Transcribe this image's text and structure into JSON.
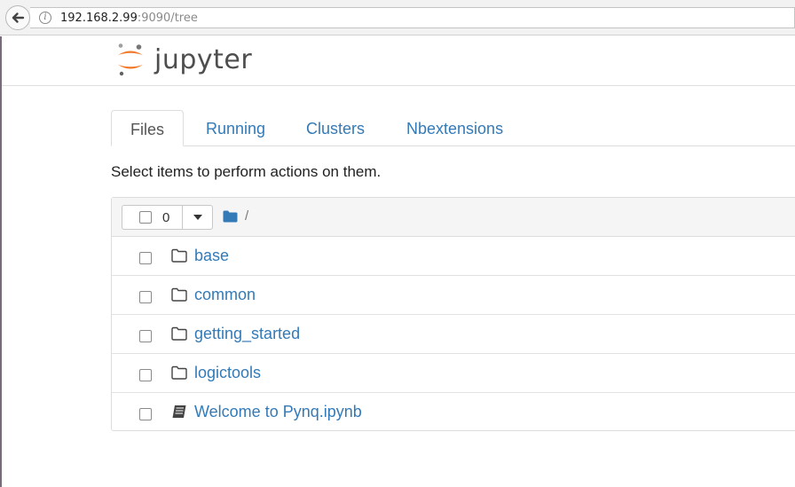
{
  "browser": {
    "url_host": "192.168.2.99",
    "url_rest": ":9090/tree"
  },
  "header": {
    "logo_text": "jupyter"
  },
  "tabs": [
    {
      "label": "Files",
      "active": true
    },
    {
      "label": "Running",
      "active": false
    },
    {
      "label": "Clusters",
      "active": false
    },
    {
      "label": "Nbextensions",
      "active": false
    }
  ],
  "instruction": "Select items to perform actions on them.",
  "file_list": {
    "selected_count": "0",
    "breadcrumb_sep": "/",
    "items": [
      {
        "name": "base",
        "type": "folder"
      },
      {
        "name": "common",
        "type": "folder"
      },
      {
        "name": "getting_started",
        "type": "folder"
      },
      {
        "name": "logictools",
        "type": "folder"
      },
      {
        "name": "Welcome to Pynq.ipynb",
        "type": "notebook"
      }
    ]
  },
  "colors": {
    "link": "#337ab7",
    "logo_orange": "#f37726",
    "panel_header": "#f5f5f5"
  }
}
